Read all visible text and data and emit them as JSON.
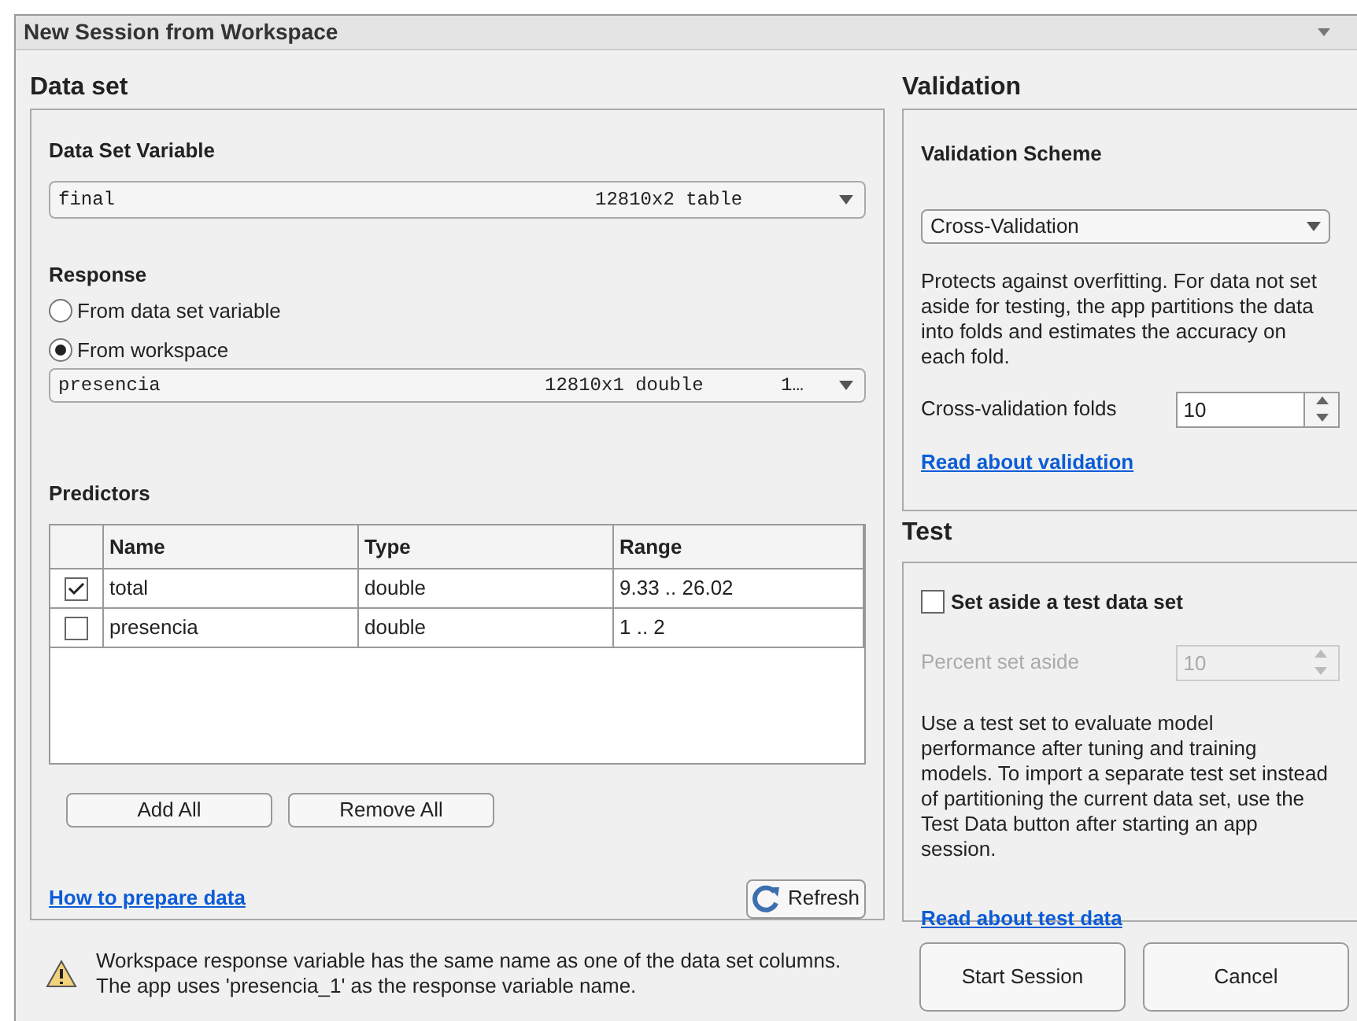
{
  "window": {
    "title": "New Session from Workspace"
  },
  "data_set": {
    "heading": "Data set",
    "variable_label": "Data Set Variable",
    "variable": {
      "name": "final",
      "size": "12810x2 table"
    },
    "response_label": "Response",
    "response_options": [
      {
        "label": "From data set variable",
        "selected": false
      },
      {
        "label": "From workspace",
        "selected": true
      }
    ],
    "response_variable": {
      "name": "presencia",
      "size": "12810x1 double",
      "extra": "1…"
    },
    "predictors_label": "Predictors",
    "table": {
      "columns": [
        "Name",
        "Type",
        "Range"
      ],
      "rows": [
        {
          "checked": true,
          "cells": [
            "total",
            "double",
            "9.33 .. 26.02"
          ]
        },
        {
          "checked": false,
          "cells": [
            "presencia",
            "double",
            "1 .. 2"
          ]
        }
      ]
    },
    "buttons": [
      "Add All",
      "Remove All"
    ],
    "help_link": "How to prepare data",
    "refresh": "Refresh"
  },
  "warning": [
    "Workspace response variable has the same name as one of the data set columns.",
    "The app uses 'presencia_1' as the response variable name."
  ],
  "validation": {
    "heading": "Validation",
    "scheme_label": "Validation Scheme",
    "scheme": "Cross-Validation",
    "description": "Protects against overfitting. For data not set aside for testing, the app partitions the data into folds and estimates the accuracy on each fold.",
    "folds_label": "Cross-validation folds",
    "folds": "10",
    "link": "Read about validation"
  },
  "test": {
    "heading": "Test",
    "checkbox": {
      "label": "Set aside a test data set",
      "checked": false
    },
    "percent_label": "Percent set aside",
    "percent": "10",
    "description": "Use a test set to evaluate model performance after tuning and training models. To import a separate test set instead of partitioning the current data set, use the Test Data button after starting an app session.",
    "link": "Read about test data"
  },
  "actions": [
    "Start Session",
    "Cancel"
  ]
}
